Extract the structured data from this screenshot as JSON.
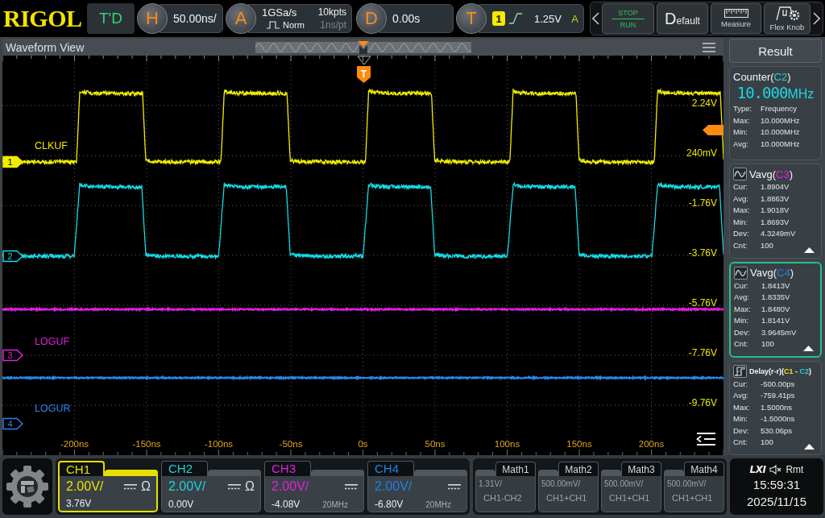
{
  "top_bar": {
    "logo": "RIGOL",
    "run_status": "T'D",
    "horizontal": {
      "key": "H",
      "scale": "50.00ns/"
    },
    "acquire": {
      "key": "A",
      "sample_rate": "1GSa/s",
      "memory_depth": "10kpts",
      "mode": "Norm",
      "resolution": "1ns/pt"
    },
    "delay": {
      "key": "D",
      "value": "0.00s"
    },
    "trigger": {
      "key": "T",
      "source": "1",
      "level": "1.25V",
      "sweep": "A"
    },
    "buttons": [
      {
        "kind": "run_stop",
        "label": "STOP",
        "sublabel": "RUN"
      },
      {
        "kind": "default",
        "label": "Default"
      },
      {
        "kind": "measure",
        "label": "Measure"
      },
      {
        "kind": "flex_knob",
        "label": "Flex Knob"
      }
    ]
  },
  "waveform_view": {
    "title": "Waveform View",
    "trigger_marker": "T",
    "traces": [
      {
        "label": "CLKUF",
        "marker": "1",
        "color": "#f2ec00",
        "kind": "square",
        "selected": true
      },
      {
        "marker": "2",
        "color": "#14dbe6",
        "kind": "square",
        "selected": false
      },
      {
        "label": "LOGUF",
        "marker": "3",
        "color": "#e41ee4",
        "kind": "flat",
        "selected": false
      },
      {
        "label": "LOGUR",
        "marker": "4",
        "color": "#2a86ec",
        "kind": "flat",
        "selected": false
      }
    ],
    "time_labels": [
      "-200ns",
      "-150ns",
      "-100ns",
      "-50ns",
      "0s",
      "50ns",
      "100ns",
      "150ns",
      "200ns"
    ],
    "voltage_labels": [
      "2.24V",
      "240mV",
      "-1.76V",
      "-3.76V",
      "-5.76V",
      "-7.76V",
      "-9.76V"
    ]
  },
  "result_panel": {
    "title": "Result",
    "measurements": [
      {
        "kind": "counter",
        "selected": false,
        "title": [
          {
            "text": "Counter("
          },
          {
            "text": "C2",
            "color": "#1ed2da"
          },
          {
            "text": ")"
          }
        ],
        "reading": "10.000",
        "unit": "MHz",
        "rows": [
          {
            "name": "Type:",
            "value": "Frequency"
          },
          {
            "name": "Max:",
            "value": "10.000MHz"
          },
          {
            "name": "Min:",
            "value": "10.000MHz"
          },
          {
            "name": "Avg:",
            "value": "10.000MHz"
          }
        ]
      },
      {
        "kind": "vavg",
        "selected": false,
        "title": [
          {
            "text": "Vavg("
          },
          {
            "text": "C3",
            "color": "#e020e0"
          },
          {
            "text": ")"
          }
        ],
        "rows": [
          {
            "name": "Cur:",
            "value": "1.8904V"
          },
          {
            "name": "Avg:",
            "value": "1.8863V"
          },
          {
            "name": "Max:",
            "value": "1.9018V"
          },
          {
            "name": "Min:",
            "value": "1.8693V"
          },
          {
            "name": "Dev:",
            "value": "4.3249mV"
          },
          {
            "name": "Cnt:",
            "value": "100"
          }
        ]
      },
      {
        "kind": "vavg",
        "selected": true,
        "title": [
          {
            "text": "Vavg("
          },
          {
            "text": "C4",
            "color": "#1f7fe6"
          },
          {
            "text": ")"
          }
        ],
        "rows": [
          {
            "name": "Cur:",
            "value": "1.8413V"
          },
          {
            "name": "Avg:",
            "value": "1.8335V"
          },
          {
            "name": "Max:",
            "value": "1.8480V"
          },
          {
            "name": "Min:",
            "value": "1.8141V"
          },
          {
            "name": "Dev:",
            "value": "3.9645mV"
          },
          {
            "name": "Cnt:",
            "value": "100"
          }
        ]
      },
      {
        "kind": "delay",
        "selected": false,
        "title": [
          {
            "text": "Delay(r-r)("
          },
          {
            "text": "C1",
            "color": "#e6e000"
          },
          {
            "text": " - "
          },
          {
            "text": "C2",
            "color": "#1ed2da"
          },
          {
            "text": ")"
          }
        ],
        "rows": [
          {
            "name": "Cur:",
            "value": "-500.00ps"
          },
          {
            "name": "Avg:",
            "value": "-759.41ps"
          },
          {
            "name": "Max:",
            "value": "1.5000ns"
          },
          {
            "name": "Min:",
            "value": "-1.5000ns"
          },
          {
            "name": "Dev:",
            "value": "530.06ps"
          },
          {
            "name": "Cnt:",
            "value": "100"
          }
        ]
      }
    ]
  },
  "channels": [
    {
      "label": "CH1",
      "color": "#e6e000",
      "selected": true,
      "scale": "2.00V/",
      "offset": "3.76V",
      "impedance": "Ω"
    },
    {
      "label": "CH2",
      "color": "#1ed2da",
      "selected": false,
      "scale": "2.00V/",
      "offset": "0.00V",
      "impedance": "Ω"
    },
    {
      "label": "CH3",
      "color": "#e020e0",
      "selected": false,
      "scale": "2.00V/",
      "offset": "-4.08V",
      "bandwidth": "20MHz"
    },
    {
      "label": "CH4",
      "color": "#1f7fe6",
      "selected": false,
      "scale": "2.00V/",
      "offset": "-6.80V",
      "bandwidth": "20MHz"
    }
  ],
  "math": [
    {
      "label": "Math1",
      "scale": "1.31V/",
      "source": "CH1-CH2"
    },
    {
      "label": "Math2",
      "scale": "500.00mV/",
      "source": "CH1+CH1"
    },
    {
      "label": "Math3",
      "scale": "500.00mV/",
      "source": "CH1+CH1"
    },
    {
      "label": "Math4",
      "scale": "500.00mV/",
      "source": "CH1+CH1"
    }
  ],
  "status": {
    "lxi": "LXI",
    "remote": "Rmt",
    "time": "15:59:31",
    "date": "2025/11/15"
  }
}
